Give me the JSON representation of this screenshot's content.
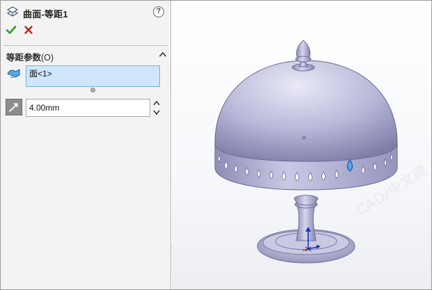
{
  "panel": {
    "title": "曲面-等距1",
    "help_glyph": "?",
    "ok_icon": "check-icon",
    "cancel_icon": "x-icon",
    "group": {
      "label": "等距参数",
      "count": "(O)"
    },
    "faces": {
      "icon": "face-selection-icon",
      "items": [
        "面<1>"
      ]
    },
    "distance": {
      "icon": "offset-direction-icon",
      "value": "4.00mm"
    }
  },
  "viewport": {
    "watermark": "CAD/中文网 www.cadzxw.com"
  },
  "colors": {
    "selection_blue": "#cfe6fb",
    "selection_border": "#6db3ea",
    "ok_green": "#2f9a2f",
    "cancel_red": "#c0201a",
    "model_body": "#b3b3d6"
  }
}
